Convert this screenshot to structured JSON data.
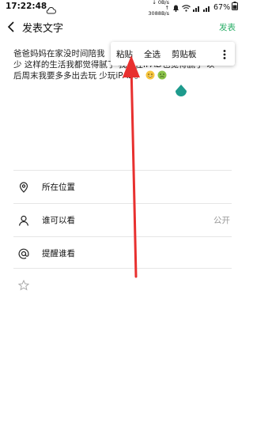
{
  "status_bar": {
    "time": "17:22:48",
    "speed_down": "↓ 0B/s",
    "speed_up": "↑ 3088B/s",
    "battery": "67%"
  },
  "header": {
    "title": "发表文字",
    "publish": "发表"
  },
  "compose": {
    "text_line1": "爸爸妈妈在家没时间陪我",
    "text_line2": "少 这样的生活我都觉得腻了 我现在iPAD也觉得腻了 以",
    "text_line3": "后周末我要多多出去玩 少玩iPAD。"
  },
  "context_menu": {
    "items": [
      "粘贴",
      "全选",
      "剪贴板"
    ]
  },
  "options": {
    "location": "所在位置",
    "visibility": "谁可以看",
    "visibility_value": "公开",
    "remind": "提醒谁看"
  },
  "colors": {
    "accent_green": "#2aae67",
    "arrow_red": "#e8302f",
    "handle_teal": "#1e9b8d"
  }
}
